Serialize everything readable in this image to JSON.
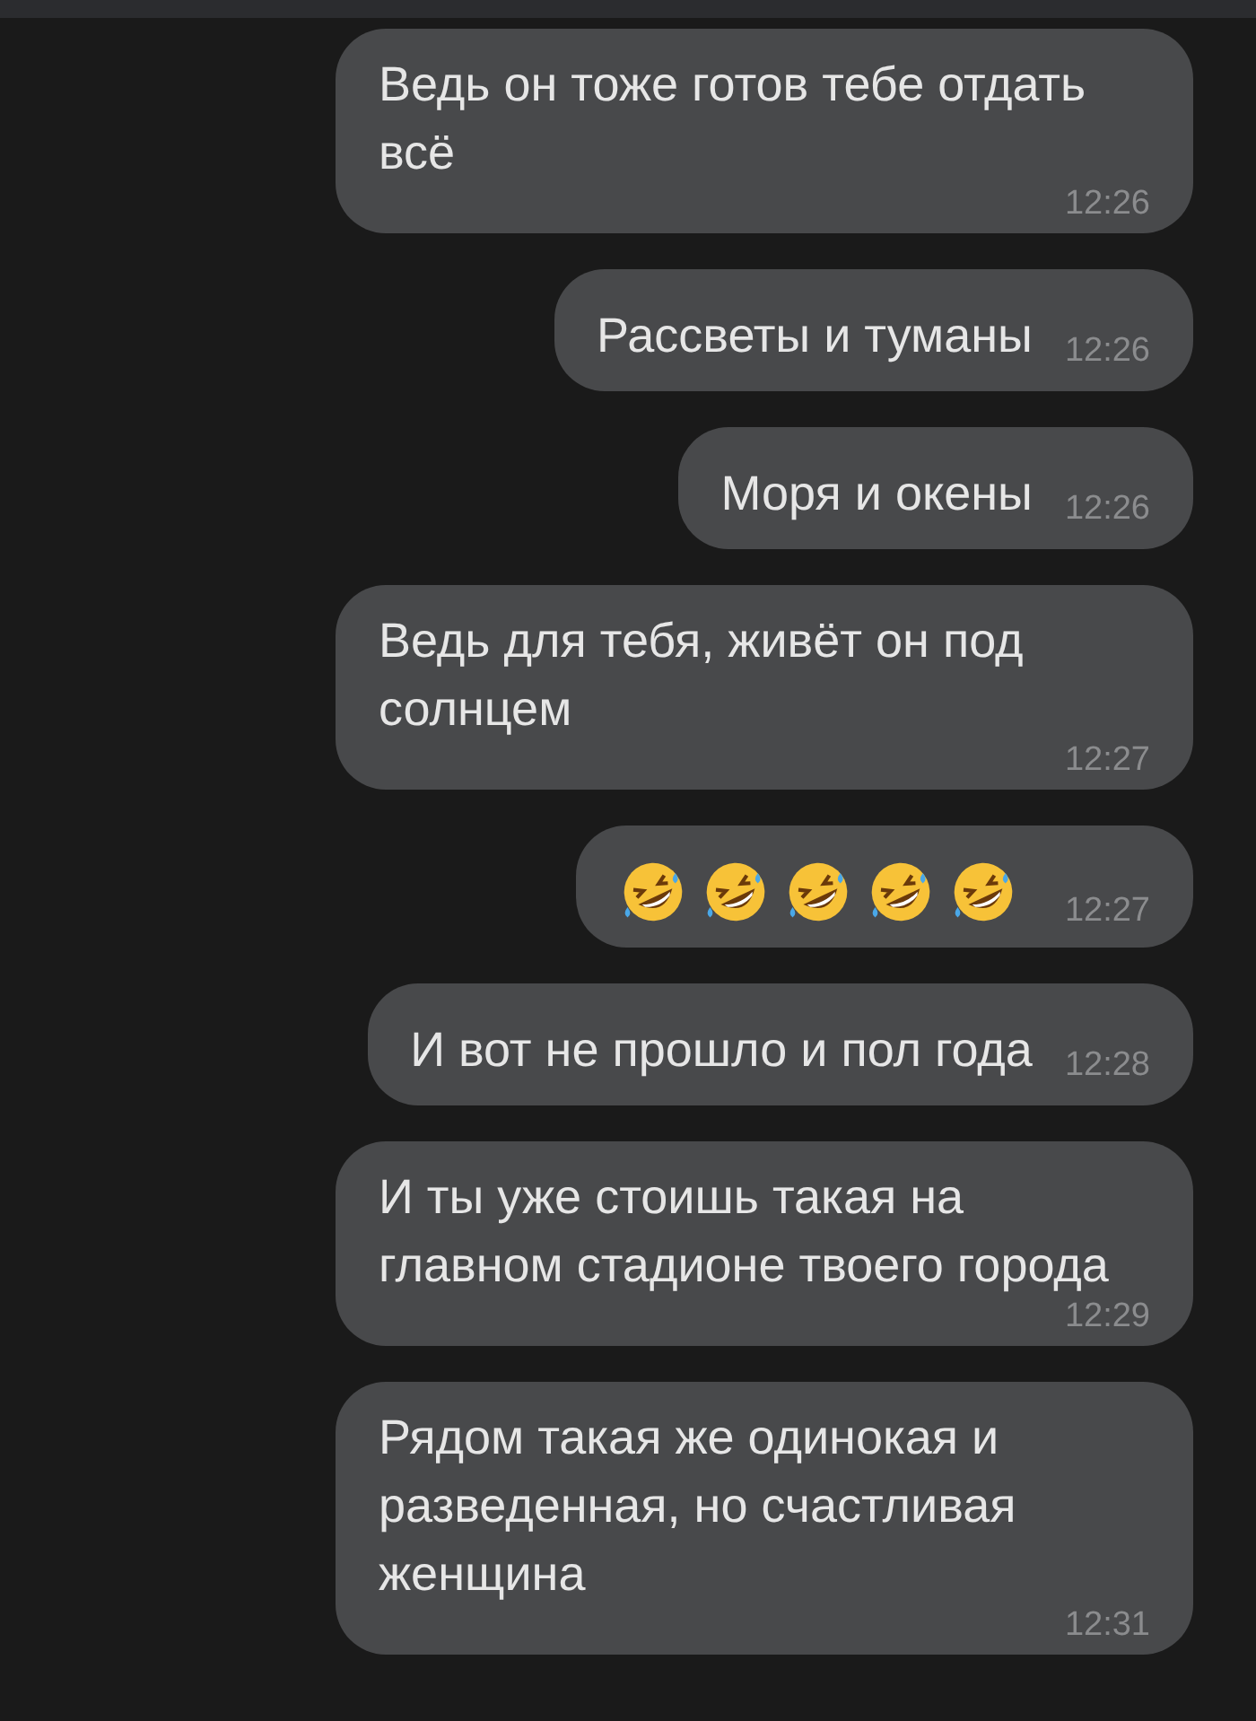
{
  "messages": [
    {
      "kind": "text",
      "text": "Ведь он тоже готов тебе отдать всё",
      "time": "12:26"
    },
    {
      "kind": "text",
      "text": "Рассветы и туманы",
      "time": "12:26"
    },
    {
      "kind": "text",
      "text": "Моря и окены",
      "time": "12:26"
    },
    {
      "kind": "text",
      "text": "Ведь для тебя, живёт он под солнцем",
      "time": "12:27"
    },
    {
      "kind": "emoji",
      "emojis": [
        {
          "kind": "rofl"
        },
        {
          "kind": "rofl"
        },
        {
          "kind": "rofl"
        },
        {
          "kind": "rofl"
        },
        {
          "kind": "rofl"
        }
      ],
      "time": "12:27"
    },
    {
      "kind": "text",
      "text": "И вот не прошло и пол года",
      "time": "12:28"
    },
    {
      "kind": "text",
      "text": "И ты уже стоишь такая на главном стадионе твоего города",
      "time": "12:29"
    },
    {
      "kind": "text",
      "text": "Рядом такая же одинокая и разведенная, но счастливая женщина",
      "time": "12:31"
    }
  ]
}
